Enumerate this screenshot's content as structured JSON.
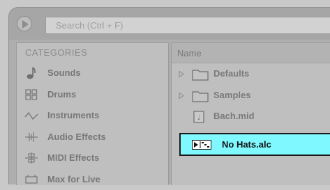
{
  "search": {
    "placeholder": "Search (Ctrl + F)"
  },
  "categories": {
    "header": "CATEGORIES",
    "items": [
      {
        "label": "Sounds",
        "icon": "note-icon"
      },
      {
        "label": "Drums",
        "icon": "drum-grid-icon"
      },
      {
        "label": "Instruments",
        "icon": "waveform-icon"
      },
      {
        "label": "Audio Effects",
        "icon": "audio-effects-icon"
      },
      {
        "label": "MIDI Effects",
        "icon": "midi-effects-icon"
      },
      {
        "label": "Max for Live",
        "icon": "max-for-live-icon"
      }
    ]
  },
  "files": {
    "header": "Name",
    "rows": [
      {
        "label": "Defaults",
        "type": "folder"
      },
      {
        "label": "Samples",
        "type": "folder"
      },
      {
        "label": "Bach.mid",
        "type": "midi-file"
      }
    ],
    "selected": {
      "label": "No Hats.alc",
      "type": "live-clip"
    }
  },
  "colors": {
    "selection": "#7ff8ff",
    "panel": "#bfbfbf"
  }
}
